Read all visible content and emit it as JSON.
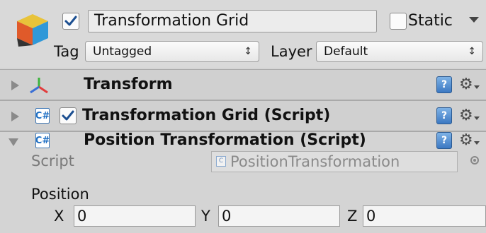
{
  "gameobject": {
    "icon": "cube-icon",
    "active": true,
    "name": "Transformation Grid",
    "static_label": "Static",
    "static": false,
    "tag_label": "Tag",
    "tag_value": "Untagged",
    "layer_label": "Layer",
    "layer_value": "Default"
  },
  "components": [
    {
      "title": "Transform",
      "expanded": false,
      "icon": "transform-axes-icon",
      "has_enable_checkbox": false
    },
    {
      "title": "Transformation Grid (Script)",
      "expanded": false,
      "icon": "script-icon",
      "has_enable_checkbox": true,
      "enabled": true
    },
    {
      "title": "Position Transformation (Script)",
      "expanded": true,
      "icon": "script-icon",
      "has_enable_checkbox": false
    }
  ],
  "position_transformation": {
    "script_label": "Script",
    "script_value": "PositionTransformation",
    "position_label": "Position",
    "x_label": "X",
    "x_value": "0",
    "y_label": "Y",
    "y_value": "0",
    "z_label": "Z",
    "z_value": "0"
  },
  "colors": {
    "panel_bg": "#d4d4d4",
    "component_header_bg": "#d0d0d0",
    "accent_blue": "#3b78c2",
    "checkmark": "#1c4f91"
  }
}
